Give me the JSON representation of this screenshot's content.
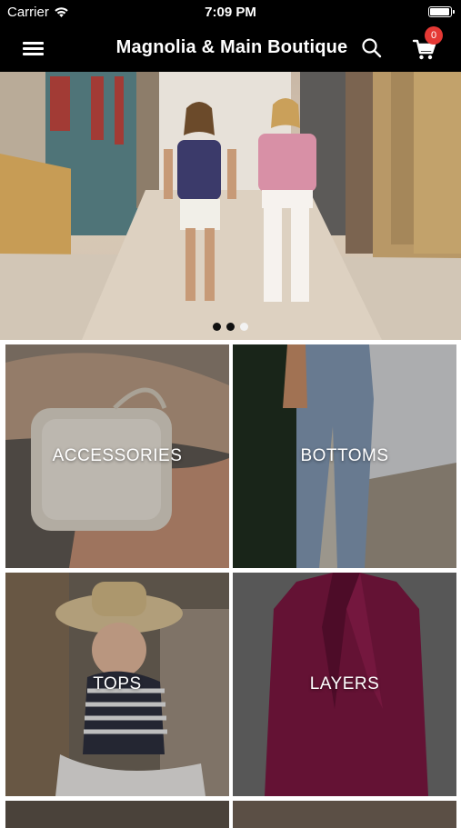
{
  "status_bar": {
    "carrier": "Carrier",
    "time": "7:09 PM",
    "battery_level": 0.95
  },
  "nav": {
    "title": "Magnolia & Main Boutique",
    "cart_count": "0"
  },
  "hero": {
    "slide_count": 3,
    "active_slide": 3
  },
  "categories": [
    {
      "label": "ACCESSORIES"
    },
    {
      "label": "BOTTOMS"
    },
    {
      "label": "TOPS"
    },
    {
      "label": "LAYERS"
    }
  ],
  "colors": {
    "bar_bg": "#000000",
    "badge": "#e53935",
    "layers_jacket": "#7a1640"
  }
}
